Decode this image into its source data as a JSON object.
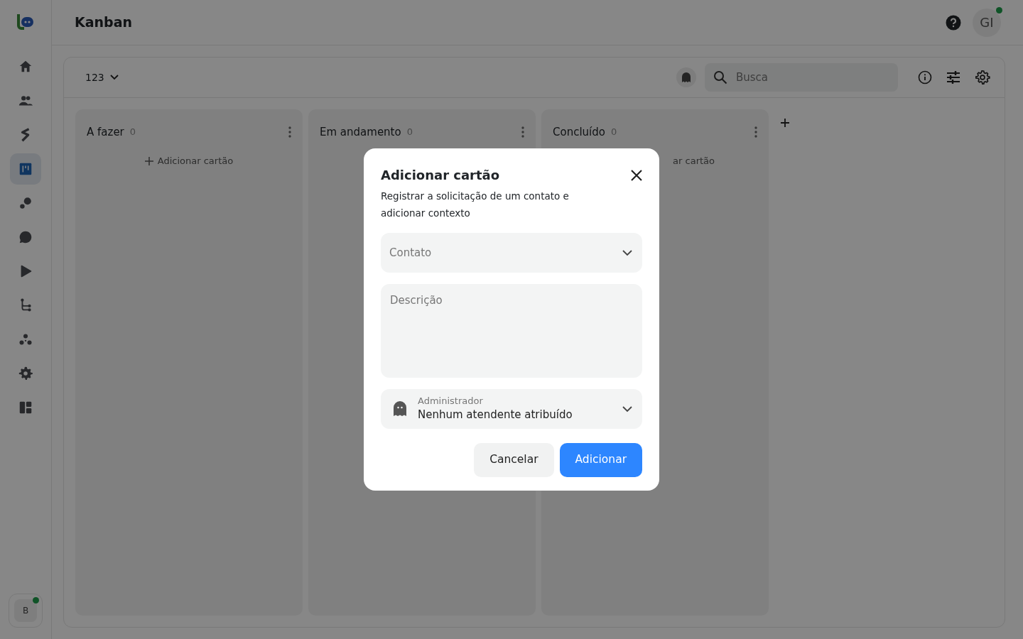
{
  "header": {
    "title": "Kanban",
    "avatar": "GI"
  },
  "sidebar": {
    "items": [
      {
        "selected": false
      },
      {
        "selected": false
      },
      {
        "selected": false
      },
      {
        "selected": true
      },
      {
        "selected": false
      },
      {
        "selected": false
      },
      {
        "selected": false
      },
      {
        "selected": false
      },
      {
        "selected": false
      },
      {
        "selected": false
      },
      {
        "selected": false
      }
    ],
    "workspace": "B"
  },
  "toolbar": {
    "board": "123",
    "search": {
      "placeholder": "Busca"
    }
  },
  "columns": [
    {
      "title": "A fazer",
      "count": "0",
      "add_label": "Adicionar cartão",
      "clipped": false
    },
    {
      "title": "Em andamento",
      "count": "0"
    },
    {
      "title": "Concluído",
      "count": "0",
      "add_label": "ar cartão",
      "clipped": true
    }
  ],
  "dialog": {
    "title": "Adicionar cartão",
    "subtitle": "Registrar a solicitação de um contato e adicionar contexto",
    "contact": {
      "placeholder": "Contato"
    },
    "description": {
      "placeholder": "Descrição"
    },
    "assignee": {
      "label": "Administrador",
      "value": "Nenhum atendente atribuído"
    },
    "buttons": [
      {
        "label": "Cancelar",
        "kind": "secondary"
      },
      {
        "label": "Adicionar",
        "kind": "primary"
      }
    ]
  }
}
